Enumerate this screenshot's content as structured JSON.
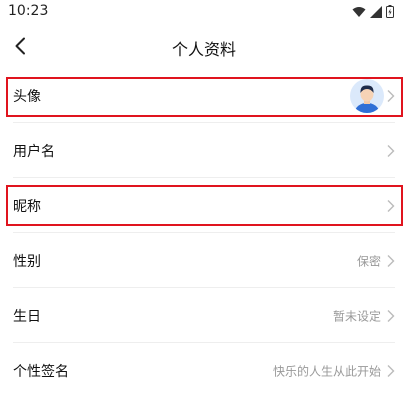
{
  "status_bar": {
    "time": "10:23"
  },
  "header": {
    "title": "个人资料"
  },
  "rows": [
    {
      "label": "头像",
      "value": ""
    },
    {
      "label": "用户名",
      "value": ""
    },
    {
      "label": "昵称",
      "value": ""
    },
    {
      "label": "性别",
      "value": "保密"
    },
    {
      "label": "生日",
      "value": "暂未设定"
    },
    {
      "label": "个性签名",
      "value": "快乐的人生从此开始"
    }
  ],
  "icons": {
    "back": "back-arrow-icon",
    "wifi": "wifi-icon",
    "signal": "signal-icon",
    "battery": "battery-icon",
    "chevron": "chevron-right-icon",
    "avatar": "user-avatar"
  },
  "colors": {
    "highlight": "#e0141e",
    "avatar_bg": "#dbe9fb",
    "avatar_shirt": "#2f6fd6",
    "text_secondary": "#999999"
  }
}
